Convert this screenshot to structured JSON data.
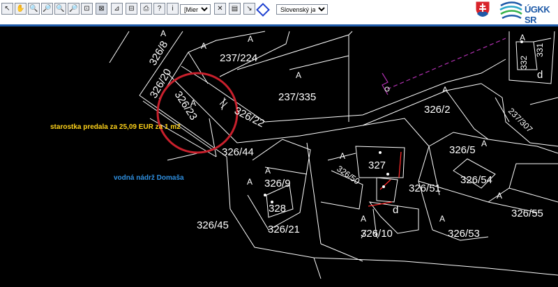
{
  "toolbar": {
    "scale_select": "[Mierka]",
    "language_select": "Slovenský jazyk",
    "tools": [
      {
        "name": "select-arrow-icon",
        "glyph": "↖"
      },
      {
        "name": "pan-hand-icon",
        "glyph": "✋"
      },
      {
        "name": "zoom-in-icon",
        "glyph": "🔍"
      },
      {
        "name": "zoom-out-icon",
        "glyph": "🔎"
      },
      {
        "name": "zoom-window-icon",
        "glyph": "🔍"
      },
      {
        "name": "zoom-previous-icon",
        "glyph": "🔎"
      },
      {
        "name": "zoom-extent-icon",
        "glyph": "⊡"
      },
      {
        "name": "clear-icon",
        "glyph": "⊠"
      },
      {
        "name": "measure-icon",
        "glyph": "⊿"
      },
      {
        "name": "scale-icon",
        "glyph": "⊟"
      },
      {
        "name": "print-icon",
        "glyph": "⎙"
      },
      {
        "name": "help-icon",
        "glyph": "?"
      },
      {
        "name": "info-icon",
        "glyph": "i"
      },
      {
        "name": "identify-icon",
        "glyph": "✕"
      },
      {
        "name": "layers-icon",
        "glyph": "▤"
      },
      {
        "name": "download-icon",
        "glyph": "↘"
      }
    ]
  },
  "logo": {
    "text": "ÚGKK SR"
  },
  "annotations": {
    "price_note": "starostka predala za 25,09 EUR za 1 m2",
    "reservoir": "vodná nádrž Domaša"
  },
  "map": {
    "parcels": [
      "326/8",
      "237/224",
      "326/20",
      "326/23",
      "237/335",
      "326/22",
      "326/2",
      "332",
      "331",
      "237/307",
      "326/44",
      "326/5",
      "327",
      "326/50",
      "326/9",
      "326/54",
      "328",
      "326/51",
      "326/55",
      "326/45",
      "326/21",
      "326/10",
      "326/53"
    ],
    "symbol_glyph": "A",
    "building_glyph": "d",
    "colors": {
      "lines": "#ffffff",
      "highlight_circle": "#c8202c",
      "dashed_line": "#b030b0",
      "red_line": "#ff2a2a",
      "price_note": "#ffd31a",
      "reservoir_label": "#2e8fe0"
    }
  }
}
